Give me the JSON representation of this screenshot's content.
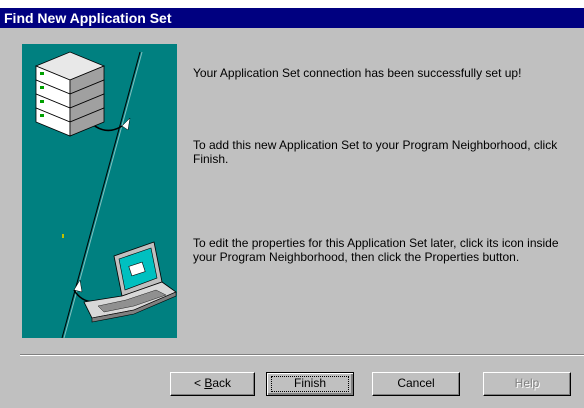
{
  "window": {
    "title": "Find New Application Set"
  },
  "messages": {
    "success": "Your Application Set connection has been successfully set up!",
    "finish_hint": "To add this new Application Set to your Program Neighborhood, click Finish.",
    "edit_hint": "To edit the properties for this Application Set later, click its icon inside your Program Neighborhood, then click the Properties button."
  },
  "buttons": {
    "back_prefix": "< ",
    "back_mnemonic": "B",
    "back_rest": "ack",
    "finish": "Finish",
    "cancel": "Cancel",
    "help": "Help"
  },
  "illustration": {
    "server_icon": "server-stack-icon",
    "laptop_icon": "laptop-icon",
    "background_color": "#008080"
  },
  "colors": {
    "titlebar": "#000080",
    "dialog": "#c0c0c0"
  }
}
